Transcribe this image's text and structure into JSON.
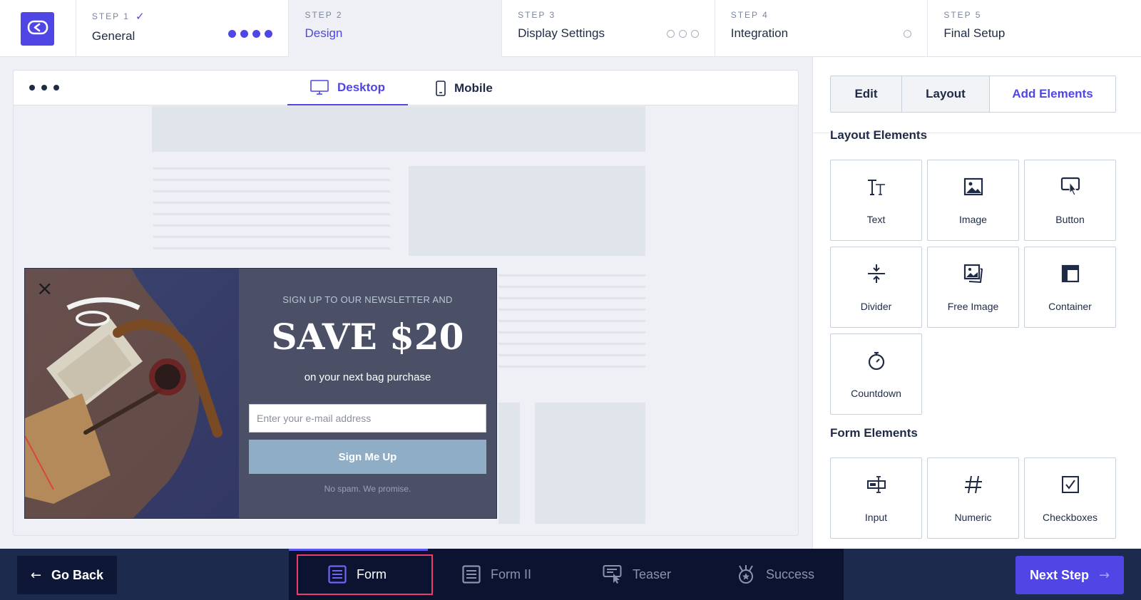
{
  "steps": [
    {
      "num": "STEP 1",
      "check": "✓",
      "name": "General",
      "dots": "filled4"
    },
    {
      "num": "STEP 2",
      "name": "Design"
    },
    {
      "num": "STEP 3",
      "name": "Display Settings",
      "dots": "empty3"
    },
    {
      "num": "STEP 4",
      "name": "Integration",
      "dots": "empty1"
    },
    {
      "num": "STEP 5",
      "name": "Final Setup"
    }
  ],
  "preview": {
    "tabs": {
      "desktop": "Desktop",
      "mobile": "Mobile"
    }
  },
  "popup": {
    "close": "×",
    "pretitle": "SIGN UP TO OUR NEWSLETTER AND",
    "title": "SAVE $20",
    "subtitle": "on your next bag purchase",
    "email_placeholder": "Enter your e-mail address",
    "button": "Sign Me Up",
    "note": "No spam. We promise."
  },
  "sidebar": {
    "tabs": [
      "Edit",
      "Layout",
      "Add Elements"
    ],
    "active_tab": "Add Elements",
    "layout_title": "Layout Elements",
    "layout_elements": [
      {
        "label": "Text",
        "icon": "text-icon"
      },
      {
        "label": "Image",
        "icon": "image-icon"
      },
      {
        "label": "Button",
        "icon": "button-icon"
      },
      {
        "label": "Divider",
        "icon": "divider-icon"
      },
      {
        "label": "Free Image",
        "icon": "free-image-icon"
      },
      {
        "label": "Container",
        "icon": "container-icon"
      },
      {
        "label": "Countdown",
        "icon": "countdown-icon"
      }
    ],
    "form_title": "Form Elements",
    "form_elements": [
      {
        "label": "Input",
        "icon": "input-icon"
      },
      {
        "label": "Numeric",
        "icon": "numeric-icon"
      },
      {
        "label": "Checkboxes",
        "icon": "checkbox-icon"
      }
    ]
  },
  "bottom": {
    "back": "Go Back",
    "next": "Next Step",
    "pages": [
      {
        "label": "Form",
        "icon": "form-icon",
        "active": true
      },
      {
        "label": "Form II",
        "icon": "form-icon"
      },
      {
        "label": "Teaser",
        "icon": "teaser-icon"
      },
      {
        "label": "Success",
        "icon": "success-icon"
      }
    ]
  },
  "colors": {
    "accent": "#4f46e5",
    "highlight": "#ee3c6b",
    "bottom_bar": "#1c2a4e",
    "popup_bg": "#4b5067"
  }
}
